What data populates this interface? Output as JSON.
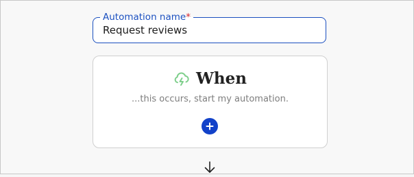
{
  "automation_name": {
    "label": "Automation name",
    "required_marker": "*",
    "value": "Request reviews"
  },
  "when_card": {
    "icon": "cloud-lightning-icon",
    "title": "When",
    "subtitle": "...this occurs, start my automation.",
    "add_icon": "plus-circle-icon"
  },
  "flow": {
    "arrow_icon": "arrow-down-icon"
  },
  "colors": {
    "accent": "#1a4fbf",
    "add_button": "#1242c9",
    "required": "#d6262e",
    "trigger_icon": "#7fcf8c"
  }
}
